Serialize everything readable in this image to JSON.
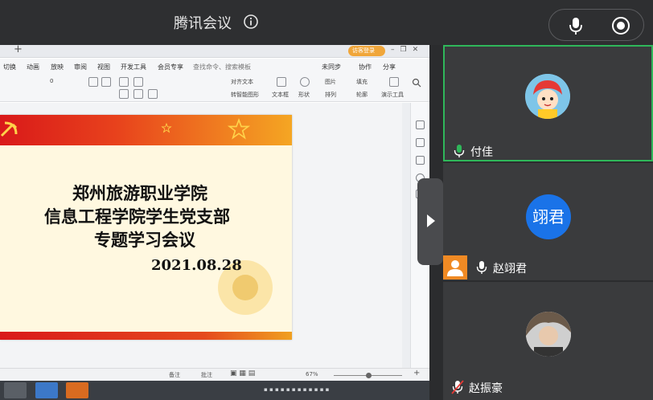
{
  "header": {
    "app_title": "腾讯会议"
  },
  "share": {
    "login_label": "访客登录",
    "menu": [
      "切换",
      "动画",
      "放映",
      "审阅",
      "视图",
      "开发工具",
      "会员专享",
      "查找命令、搜索模板"
    ],
    "menu_right": [
      "未同步",
      "协作",
      "分享"
    ],
    "toolbar": {
      "font_size": "0",
      "text_dir": "对齐文本",
      "smart_shape": "转智能图形",
      "textbox": "文本框",
      "shape": "形状",
      "picture": "图片",
      "arrange": "排列",
      "fill": "填充",
      "outline": "轮廓",
      "presenter_tools": "演示工具"
    },
    "slide": {
      "line1": "郑州旅游职业学院",
      "line2": "信息工程学院学生党支部",
      "line3": "专题学习会议",
      "date": "2021.08.28"
    },
    "status": {
      "notes": "备注",
      "comments": "批注",
      "zoom": "67%"
    }
  },
  "participants": [
    {
      "name": "付佳",
      "mic": "on",
      "avatar": "cartoon-girl"
    },
    {
      "name": "赵翊君",
      "mic": "on",
      "avatar_text": "翊君"
    },
    {
      "name": "赵振豪",
      "mic": "muted",
      "avatar": "photo"
    }
  ],
  "colors": {
    "active_speaker": "#2fb75a",
    "avatar_blue": "#1a73e8",
    "slide_red": "#d9191a"
  }
}
